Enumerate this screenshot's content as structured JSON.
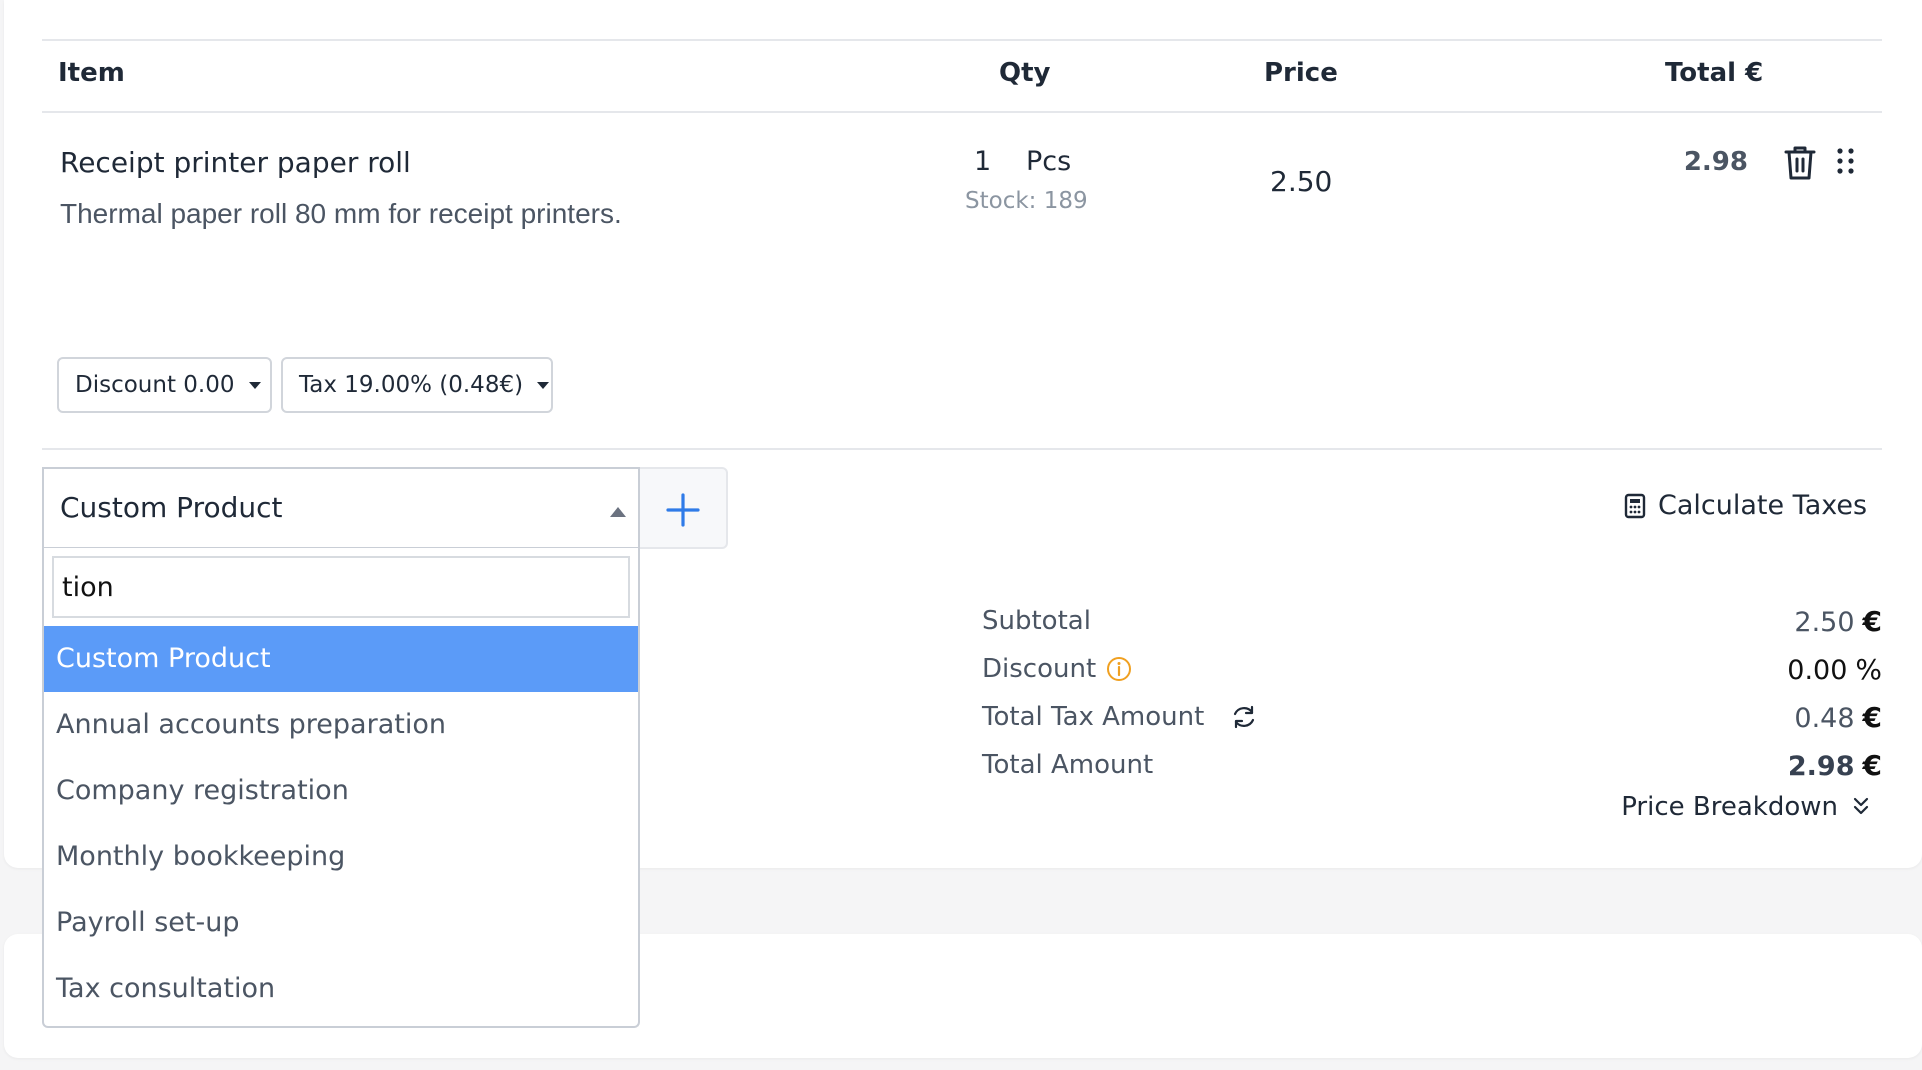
{
  "table": {
    "headers": {
      "item": "Item",
      "qty": "Qty",
      "price": "Price",
      "total": "Total €"
    }
  },
  "line_item": {
    "name": "Receipt printer paper roll",
    "description": "Thermal paper roll 80 mm for receipt printers.",
    "qty": "1",
    "unit": "Pcs",
    "stock": "Stock: 189",
    "price": "2.50",
    "total": "2.98",
    "discount_button": "Discount 0.00",
    "tax_button": "Tax 19.00% (0.48€)"
  },
  "product_select": {
    "selected": "Custom Product",
    "search_value": "tion",
    "options": [
      "Custom Product",
      "Annual accounts preparation",
      "Company registration",
      "Monthly bookkeeping",
      "Payroll set-up",
      "Tax consultation"
    ],
    "active_index": 0
  },
  "calculate_taxes_label": "Calculate Taxes",
  "summary": {
    "subtotal_label": "Subtotal",
    "subtotal_value": "2.50",
    "subtotal_unit": "€",
    "discount_label": "Discount",
    "discount_value": "0.00",
    "discount_unit": "%",
    "tax_label": "Total Tax Amount",
    "tax_value": "0.48",
    "tax_unit": "€",
    "total_label": "Total Amount",
    "total_value": "2.98",
    "total_unit": "€",
    "price_breakdown": "Price Breakdown"
  },
  "colors": {
    "accent": "#5b9bf8",
    "plus_icon": "#2f7be8",
    "info_icon": "#f0a020"
  },
  "icons": [
    "trash-icon",
    "drag-handle-icon",
    "plus-icon",
    "calculator-icon",
    "info-icon",
    "refresh-icon",
    "double-chevron-down-icon"
  ]
}
